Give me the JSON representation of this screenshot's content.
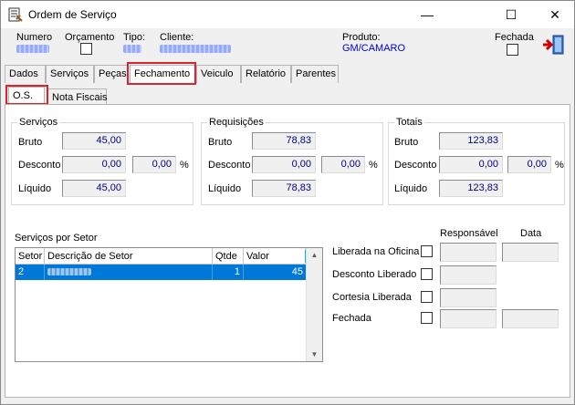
{
  "window": {
    "title": "Ordem de Serviço",
    "minimize": "—",
    "maximize": "☐",
    "close": "✕"
  },
  "header": {
    "numero_label": "Numero",
    "orcamento_label": "Orçamento",
    "tipo_label": "Tipo:",
    "cliente_label": "Cliente:",
    "produto_label": "Produto:",
    "produto_value": "GM/CAMARO",
    "fechada_label": "Fechada"
  },
  "tabs": [
    "Dados",
    "Serviços",
    "Peças",
    "Fechamento",
    "Veiculo",
    "Relatório",
    "Parentes"
  ],
  "subtabs": [
    "O.S.",
    "Nota Fiscais"
  ],
  "servicos": {
    "title": "Serviços",
    "bruto_label": "Bruto",
    "bruto": "45,00",
    "desconto_label": "Desconto",
    "desconto": "0,00",
    "desconto_pct": "0,00",
    "pct_symbol": "%",
    "liquido_label": "Líquido",
    "liquido": "45,00"
  },
  "requisicoes": {
    "title": "Requisições",
    "bruto_label": "Bruto",
    "bruto": "78,83",
    "desconto_label": "Desconto",
    "desconto": "0,00",
    "desconto_pct": "0,00",
    "pct_symbol": "%",
    "liquido_label": "Líquido",
    "liquido": "78,83"
  },
  "totais": {
    "title": "Totais",
    "bruto_label": "Bruto",
    "bruto": "123,83",
    "desconto_label": "Desconto",
    "desconto": "0,00",
    "desconto_pct": "0,00",
    "pct_symbol": "%",
    "liquido_label": "Líquido",
    "liquido": "123,83"
  },
  "setor": {
    "title": "Serviços por Setor",
    "columns": [
      "Setor",
      "Descrição de Setor",
      "Qtde",
      "Valor"
    ],
    "rows": [
      {
        "setor": "2",
        "qtde": "1",
        "valor": "45"
      }
    ]
  },
  "approvals": {
    "responsavel_header": "Responsável",
    "data_header": "Data",
    "liberada_oficina": "Liberada na Oficina",
    "desconto_liberado": "Desconto Liberado",
    "cortesia_liberada": "Cortesia  Liberada",
    "fechada": "Fechada"
  }
}
